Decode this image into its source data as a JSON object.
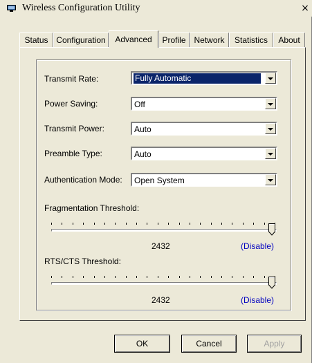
{
  "window": {
    "title": "Wireless Configuration Utility",
    "close_glyph": "×"
  },
  "tabs": [
    {
      "label": "Status"
    },
    {
      "label": "Configuration"
    },
    {
      "label": "Advanced",
      "active": true
    },
    {
      "label": "Profile"
    },
    {
      "label": "Network"
    },
    {
      "label": "Statistics"
    },
    {
      "label": "About"
    }
  ],
  "settings": {
    "transmit_rate": {
      "label": "Transmit Rate:",
      "value": "Fully Automatic"
    },
    "power_saving": {
      "label": "Power Saving:",
      "value": "Off"
    },
    "transmit_power": {
      "label": "Transmit Power:",
      "value": "Auto"
    },
    "preamble_type": {
      "label": "Preamble Type:",
      "value": "Auto"
    },
    "authentication_mode": {
      "label": "Authentication Mode:",
      "value": "Open System"
    }
  },
  "fragmentation": {
    "label": "Fragmentation Threshold:",
    "value": "2432",
    "disable_label": "(Disable)",
    "fraction": 1.0
  },
  "rts_cts": {
    "label": "RTS/CTS Threshold:",
    "value": "2432",
    "disable_label": "(Disable)",
    "fraction": 1.0
  },
  "buttons": {
    "ok": "OK",
    "cancel": "Cancel",
    "apply": "Apply"
  },
  "colors": {
    "face": "#ece9d8",
    "selection": "#0a246a",
    "link": "#0000c0"
  },
  "icons": {
    "app": "network-adapter-icon",
    "dropdown": "triangle-down-icon"
  }
}
